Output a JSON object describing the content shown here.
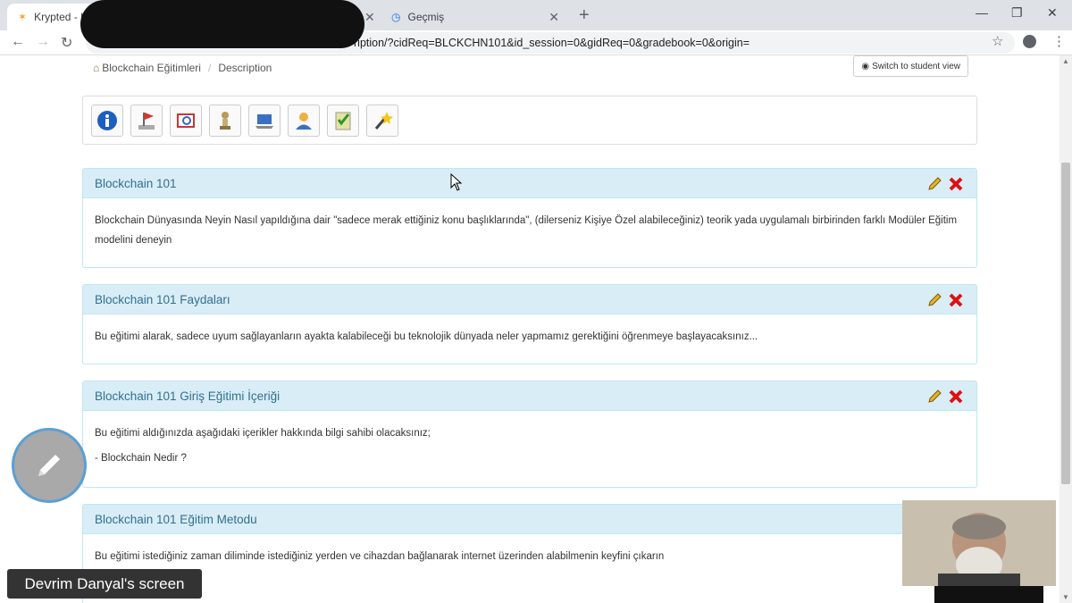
{
  "browser": {
    "tabs": [
      {
        "title": "Krypted - K",
        "active": true
      },
      {
        "title": "Geçmiş",
        "active": false
      }
    ],
    "url_visible": "ription/?cidReq=BLCKCHN101&id_session=0&gidReq=0&gradebook=0&origin="
  },
  "breadcrumb": {
    "home": "Blockchain Eğitimleri",
    "current": "Description"
  },
  "switch_button": "Switch to student view",
  "toolbar_icons": [
    "info-icon",
    "flag-icon",
    "book-icon",
    "pawn-icon",
    "laptop-icon",
    "user-icon",
    "checklist-icon",
    "wand-icon"
  ],
  "panels": [
    {
      "title": "Blockchain 101",
      "paragraphs": [
        "Blockchain Dünyasında Neyin Nasıl yapıldığına dair \"sadece merak ettiğiniz konu başlıklarında\", (dilerseniz Kişiye Özel alabileceğiniz) teorik yada uygulamalı birbirinden farklı Modüler Eğitim modelini deneyin"
      ]
    },
    {
      "title": "Blockchain 101 Faydaları",
      "paragraphs": [
        "Bu eğitimi alarak, sadece uyum sağlayanların ayakta kalabileceği bu teknolojik dünyada neler yapmamız gerektiğini öğrenmeye başlayacaksınız..."
      ]
    },
    {
      "title": "Blockchain 101 Giriş Eğitimi İçeriği",
      "paragraphs": [
        "Bu eğitimi aldığınızda aşağıdaki içerikler hakkında bilgi sahibi olacaksınız;",
        "- Blockchain Nedir ?"
      ]
    },
    {
      "title": "Blockchain 101 Eğitim Metodu",
      "paragraphs": [
        "Bu eğitimi istediğiniz zaman diliminde istediğiniz yerden ve cihazdan bağlanarak internet üzerinden alabilmenin keyfini çıkarın"
      ]
    }
  ],
  "screen_share_label": "Devrim Danyal's screen",
  "colors": {
    "panel_heading_bg": "#d9edf7",
    "panel_title": "#31708f",
    "panel_border": "#bce8f1"
  }
}
